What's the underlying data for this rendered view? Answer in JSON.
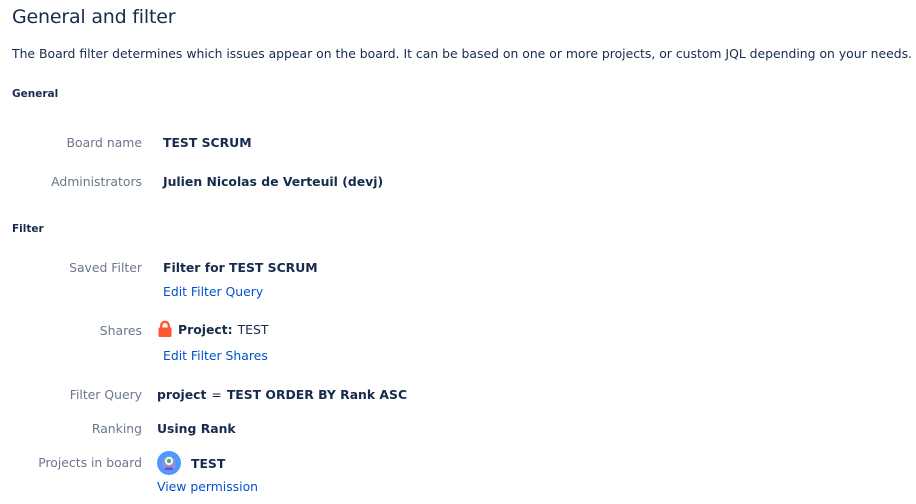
{
  "page": {
    "title": "General and filter",
    "description": "The Board filter determines which issues appear on the board. It can be based on one or more projects, or custom JQL depending on your needs."
  },
  "general": {
    "heading": "General",
    "board_name_label": "Board name",
    "board_name_value": "TEST SCRUM",
    "administrators_label": "Administrators",
    "administrators_value": "Julien Nicolas de Verteuil (devj)"
  },
  "filter": {
    "heading": "Filter",
    "saved_filter_label": "Saved Filter",
    "saved_filter_value": "Filter for TEST SCRUM",
    "edit_filter_query_link": "Edit Filter Query",
    "shares_label": "Shares",
    "shares_type": "Project:",
    "shares_project": "TEST",
    "edit_filter_shares_link": "Edit Filter Shares",
    "filter_query_label": "Filter Query",
    "filter_query_keyword": "project",
    "filter_query_operator": "=",
    "filter_query_rest": "TEST ORDER BY Rank ASC",
    "ranking_label": "Ranking",
    "ranking_value": "Using Rank",
    "projects_label": "Projects in board",
    "project_name": "TEST",
    "view_permission_link": "View permission"
  },
  "icons": {
    "lock": "lock-icon",
    "project_avatar": "project-avatar-icon"
  },
  "colors": {
    "lock": "#ff5630",
    "link": "#0052cc",
    "label": "#6b778c",
    "text": "#172b4d",
    "avatar_bg": "#4c9aff",
    "avatar_face": "#998dd9"
  }
}
